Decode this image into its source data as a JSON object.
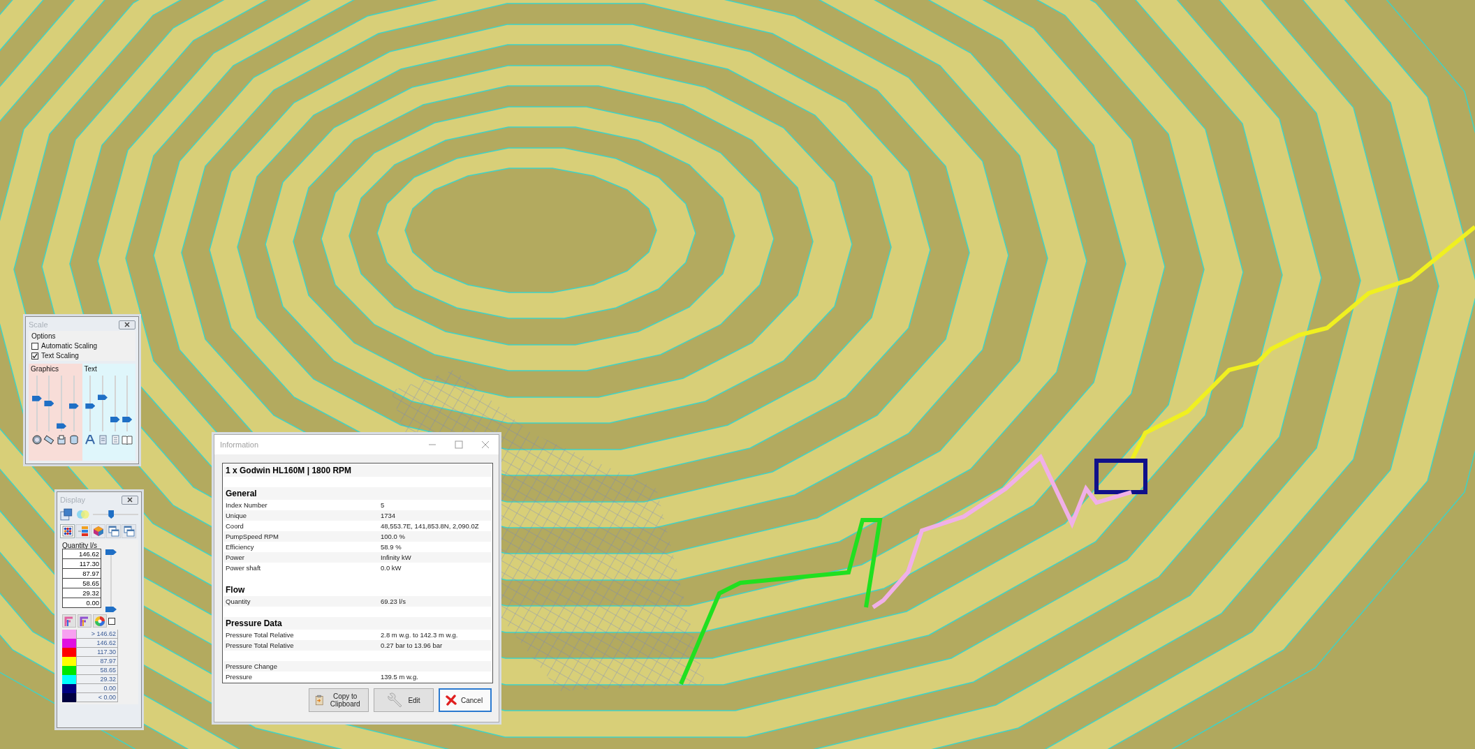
{
  "scale_panel": {
    "title": "Scale",
    "options_label": "Options",
    "options": [
      {
        "label": "Automatic Scaling",
        "checked": false
      },
      {
        "label": "Text Scaling",
        "checked": true
      }
    ],
    "groups": [
      {
        "label": "Graphics",
        "kind": "graphics",
        "sliders": [
          {
            "level": 0.6
          },
          {
            "level": 0.5
          },
          {
            "level": 0.05
          },
          {
            "level": 0.45
          }
        ]
      },
      {
        "label": "Text",
        "kind": "text",
        "sliders": [
          {
            "level": 0.45
          },
          {
            "level": 0.62
          },
          {
            "level": 0.18
          },
          {
            "level": 0.18
          }
        ]
      }
    ]
  },
  "display_panel": {
    "title": "Display",
    "opacity_slider": {
      "level": 0.38
    },
    "tabs": [
      {
        "kind": "grid",
        "selected": true
      },
      {
        "kind": "legend",
        "selected": false
      },
      {
        "kind": "cube",
        "selected": false
      },
      {
        "kind": "windows",
        "selected": false
      },
      {
        "kind": "windows",
        "selected": false
      }
    ],
    "quantity_label": "Quantity l/s",
    "values": [
      "146.62",
      "117.30",
      "87.97",
      "58.65",
      "29.32",
      "0.00"
    ],
    "range_slider": {
      "thumbs": [
        {
          "level": 1
        },
        {
          "level": 0
        }
      ]
    },
    "checkbox": {
      "checked": false
    },
    "legend": [
      {
        "color": "#f7a0f0",
        "label": "> 146.62"
      },
      {
        "color": "#e010e0",
        "label": "146.62"
      },
      {
        "color": "#ff0000",
        "label": "117.30"
      },
      {
        "color": "#ffff00",
        "label": "87.97"
      },
      {
        "color": "#00e600",
        "label": "58.65"
      },
      {
        "color": "#00ffff",
        "label": "29.32"
      },
      {
        "color": "#000080",
        "label": "0.00"
      },
      {
        "color": "#000040",
        "label": "< 0.00"
      }
    ]
  },
  "info_dialog": {
    "title": "Information",
    "rows": [
      {
        "kind": "title",
        "label": "1 x Godwin HL160M | 1800 RPM"
      },
      {
        "kind": "blank"
      },
      {
        "kind": "section",
        "label": "General"
      },
      {
        "kind": "field",
        "label": "Index Number",
        "value": "5"
      },
      {
        "kind": "field",
        "label": "Unique",
        "value": "1734"
      },
      {
        "kind": "field",
        "label": "Coord",
        "value": "48,553.7E, 141,853.8N, 2,090.0Z"
      },
      {
        "kind": "field",
        "label": "PumpSpeed RPM",
        "value": "100.0 %"
      },
      {
        "kind": "field",
        "label": "Efficiency",
        "value": "58.9 %"
      },
      {
        "kind": "field",
        "label": "Power",
        "value": "Infinity kW"
      },
      {
        "kind": "field",
        "label": "Power shaft",
        "value": "0.0 kW"
      },
      {
        "kind": "blank"
      },
      {
        "kind": "section",
        "label": "Flow"
      },
      {
        "kind": "field",
        "label": "Quantity",
        "value": "69.23 l/s"
      },
      {
        "kind": "blank"
      },
      {
        "kind": "section",
        "label": "Pressure Data"
      },
      {
        "kind": "field",
        "label": "Pressure Total Relative",
        "value": "2.8 m w.g. to 142.3 m w.g."
      },
      {
        "kind": "field",
        "label": "Pressure Total Relative",
        "value": "0.27 bar to 13.96 bar"
      },
      {
        "kind": "blank"
      },
      {
        "kind": "field",
        "label": "Pressure Change"
      },
      {
        "kind": "field",
        "label": "Pressure",
        "value": "139.5 m w.g."
      }
    ],
    "buttons": [
      {
        "kind": "copy",
        "label": "Copy to Clipboard",
        "focused": false
      },
      {
        "kind": "edit",
        "label": "Edit",
        "focused": false
      },
      {
        "kind": "cancel",
        "label": "Cancel",
        "focused": true
      }
    ]
  }
}
